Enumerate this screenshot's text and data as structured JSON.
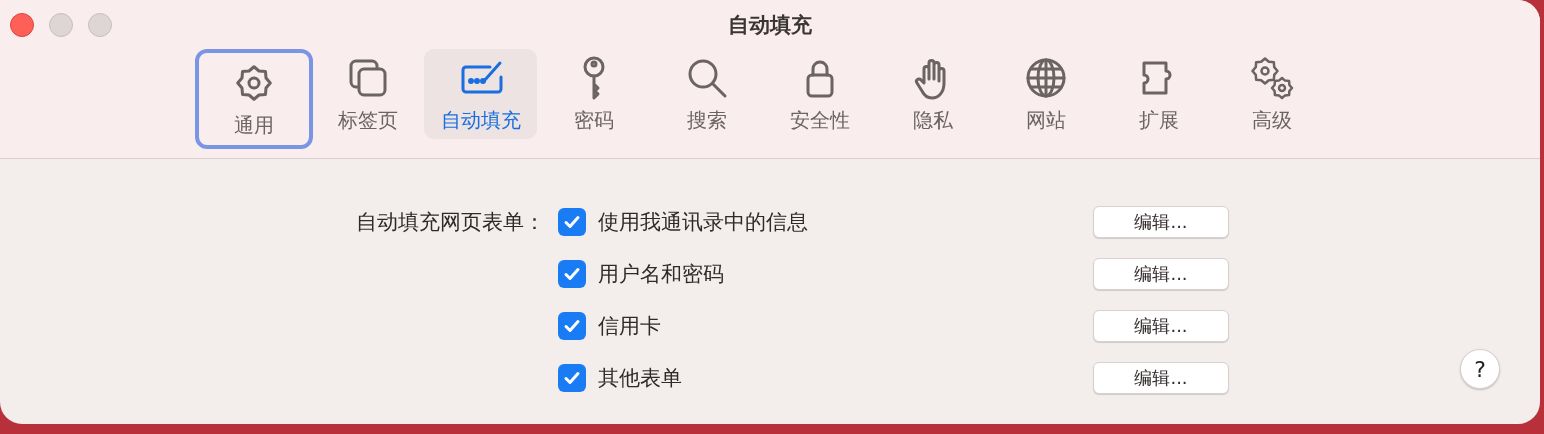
{
  "window": {
    "title": "自动填充"
  },
  "tabs": [
    {
      "label": "通用",
      "selected": false,
      "focused": true
    },
    {
      "label": "标签页",
      "selected": false,
      "focused": false
    },
    {
      "label": "自动填充",
      "selected": true,
      "focused": false
    },
    {
      "label": "密码",
      "selected": false,
      "focused": false
    },
    {
      "label": "搜索",
      "selected": false,
      "focused": false
    },
    {
      "label": "安全性",
      "selected": false,
      "focused": false
    },
    {
      "label": "隐私",
      "selected": false,
      "focused": false
    },
    {
      "label": "网站",
      "selected": false,
      "focused": false
    },
    {
      "label": "扩展",
      "selected": false,
      "focused": false
    },
    {
      "label": "高级",
      "selected": false,
      "focused": false
    }
  ],
  "form": {
    "label": "自动填充网页表单：",
    "options": [
      {
        "label": "使用我通讯录中的信息",
        "checked": true,
        "button": "编辑..."
      },
      {
        "label": "用户名和密码",
        "checked": true,
        "button": "编辑..."
      },
      {
        "label": "信用卡",
        "checked": true,
        "button": "编辑..."
      },
      {
        "label": "其他表单",
        "checked": true,
        "button": "编辑..."
      }
    ]
  },
  "help_button": "?"
}
